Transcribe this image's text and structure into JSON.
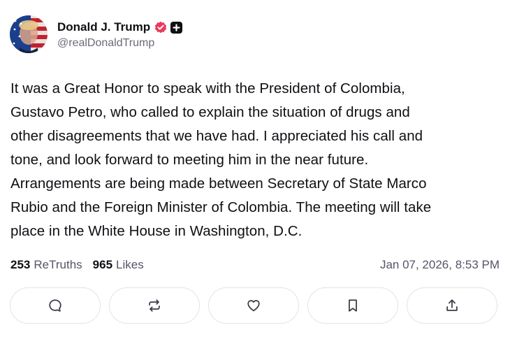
{
  "author": {
    "display_name": "Donald J. Trump",
    "handle": "@realDonaldTrump",
    "verified_icon": "verified-check-icon",
    "plus_icon": "plus-badge-icon"
  },
  "post": {
    "lines": [
      "It was a Great Honor to speak with the President of Colombia,",
      "Gustavo Petro, who called to explain the situation of drugs and",
      "other disagreements that we have had. I appreciated his call and",
      "tone, and look forward to meeting him in the near future.",
      "Arrangements are being made between Secretary of State Marco",
      "Rubio and the Foreign Minister of Colombia. The meeting will take",
      "place in the White House in Washington, D.C."
    ]
  },
  "stats": {
    "retruths_count": "253",
    "retruths_label": "ReTruths",
    "likes_count": "965",
    "likes_label": "Likes",
    "timestamp": "Jan 07, 2026, 8:53 PM"
  },
  "actions": [
    {
      "icon": "reply-icon"
    },
    {
      "icon": "retruth-icon"
    },
    {
      "icon": "like-icon"
    },
    {
      "icon": "bookmark-icon"
    },
    {
      "icon": "share-icon"
    }
  ],
  "colors": {
    "text": "#0f0f14",
    "muted": "#55556a",
    "verified": "#e9395c",
    "border": "#e3e3ea"
  }
}
